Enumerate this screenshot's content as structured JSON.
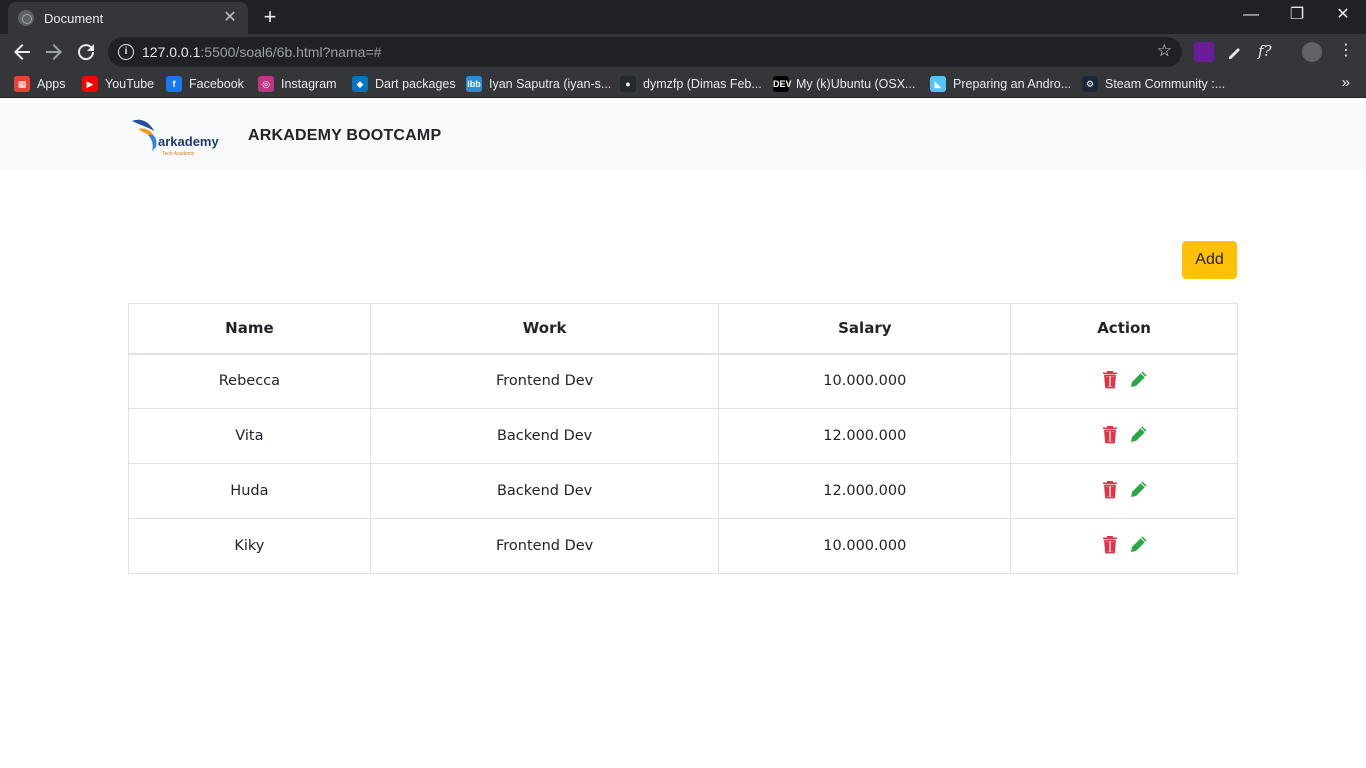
{
  "browser": {
    "tab_title": "Document",
    "url_host": "127.0.0.1",
    "url_path": ":5500/soal6/6b.html?nama=#",
    "bookmarks": [
      {
        "label": "Apps",
        "icon": "apps-grid-icon",
        "color": "#ea4335"
      },
      {
        "label": "YouTube",
        "icon": "youtube-icon",
        "color": "#ff0000"
      },
      {
        "label": "Facebook",
        "icon": "facebook-icon",
        "color": "#1877f2"
      },
      {
        "label": "Instagram",
        "icon": "instagram-icon",
        "color": "#c13584"
      },
      {
        "label": "Dart packages",
        "icon": "dart-icon",
        "color": "#0175c2"
      },
      {
        "label": "Iyan Saputra (iyan-s...",
        "icon": "ibb-icon",
        "color": "#2a8ed8"
      },
      {
        "label": "dymzfp (Dimas Feb...",
        "icon": "github-icon",
        "color": "#24292e"
      },
      {
        "label": "My (k)Ubuntu (OSX...",
        "icon": "dev-icon",
        "color": "#000000"
      },
      {
        "label": "Preparing an Andro...",
        "icon": "flutter-icon",
        "color": "#54c5f8"
      },
      {
        "label": "Steam Community :...",
        "icon": "steam-icon",
        "color": "#1b2838"
      }
    ]
  },
  "navbar": {
    "brand": "ARKADEMY BOOTCAMP",
    "logo_text": "arkademy",
    "logo_sub": "Tech Academy"
  },
  "actions": {
    "add_label": "Add"
  },
  "table": {
    "headers": [
      "Name",
      "Work",
      "Salary",
      "Action"
    ],
    "rows": [
      {
        "name": "Rebecca",
        "work": "Frontend Dev",
        "salary": "10.000.000"
      },
      {
        "name": "Vita",
        "work": "Backend Dev",
        "salary": "12.000.000"
      },
      {
        "name": "Huda",
        "work": "Backend Dev",
        "salary": "12.000.000"
      },
      {
        "name": "Kiky",
        "work": "Frontend Dev",
        "salary": "10.000.000"
      }
    ]
  },
  "colors": {
    "add_button": "#ffc107",
    "delete_icon": "#dc3545",
    "edit_icon": "#28a745",
    "navbar_bg": "#f8f9fa"
  }
}
